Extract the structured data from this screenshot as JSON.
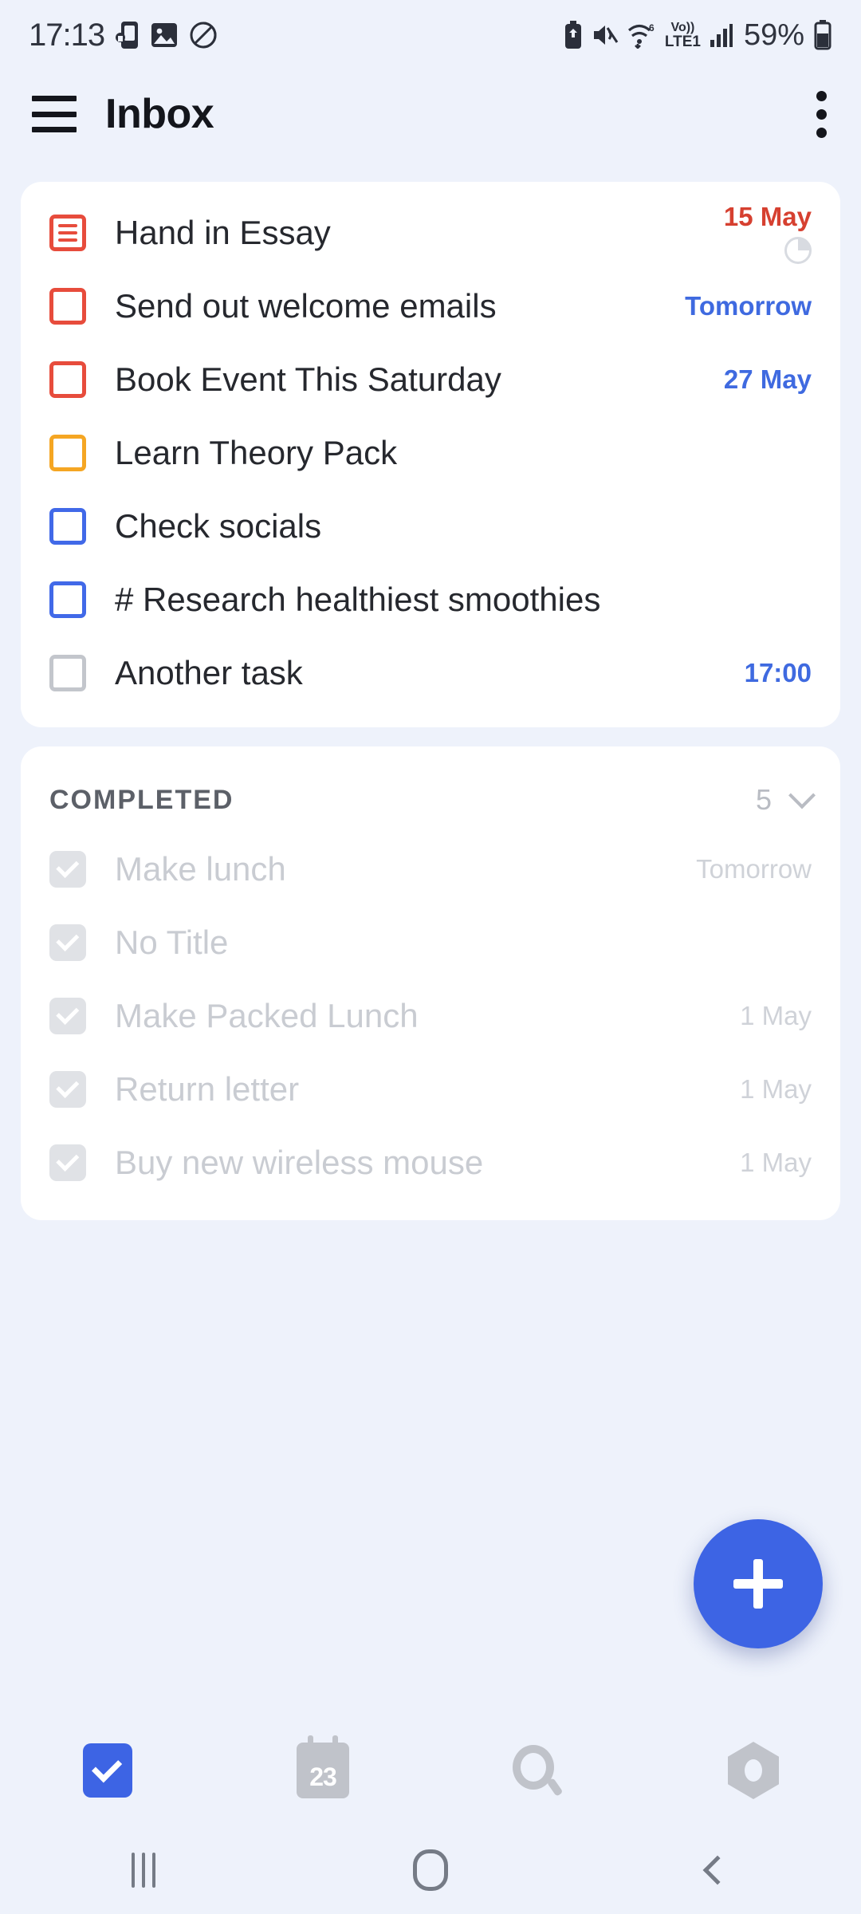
{
  "status_bar": {
    "time": "17:13",
    "left_icons": [
      "phone-lock-icon",
      "image-icon",
      "no-entry-icon"
    ],
    "right_icons": [
      "battery-saver-icon",
      "mute-vibrate-icon",
      "wifi-icon",
      "volte-icon",
      "signal-icon",
      "battery-icon"
    ],
    "wifi_generation": "6",
    "volte_top": "Vo))",
    "volte_bottom": "LTE1",
    "battery_percent": "59%"
  },
  "app_bar": {
    "menu_icon": "hamburger-icon",
    "title": "Inbox",
    "overflow_icon": "more-vertical-icon"
  },
  "colors": {
    "accent": "#3d64e4",
    "overdue": "#d64030",
    "due": "#3f6ae0",
    "priority_high": "#e74c3c",
    "priority_medium": "#f5a623",
    "priority_low": "#4169e8",
    "priority_none": "#cfd2d8",
    "background": "#eef2fb",
    "card": "#ffffff"
  },
  "tasks": [
    {
      "title": "Hand in Essay",
      "checkbox": "list",
      "checkbox_color": "red",
      "date": "15 May",
      "date_color": "red",
      "progress_icon": "pie-progress-icon"
    },
    {
      "title": "Send out welcome emails",
      "checkbox": "box",
      "checkbox_color": "red",
      "date": "Tomorrow",
      "date_color": "blue",
      "progress_icon": ""
    },
    {
      "title": "Book Event This Saturday",
      "checkbox": "box",
      "checkbox_color": "red",
      "date": "27 May",
      "date_color": "blue",
      "progress_icon": ""
    },
    {
      "title": "Learn Theory Pack",
      "checkbox": "box",
      "checkbox_color": "yellow",
      "date": "",
      "date_color": "blue",
      "progress_icon": ""
    },
    {
      "title": "Check socials",
      "checkbox": "box",
      "checkbox_color": "blue",
      "date": "",
      "date_color": "blue",
      "progress_icon": ""
    },
    {
      "title": "# Research healthiest smoothies",
      "checkbox": "box",
      "checkbox_color": "blue",
      "date": "",
      "date_color": "blue",
      "progress_icon": ""
    },
    {
      "title": "Another task",
      "checkbox": "box",
      "checkbox_color": "grey",
      "date": "17:00",
      "date_color": "blue",
      "progress_icon": ""
    }
  ],
  "completed_section": {
    "header": "COMPLETED",
    "count": "5",
    "chevron_icon": "chevron-down-icon",
    "items": [
      {
        "title": "Make lunch",
        "date": "Tomorrow"
      },
      {
        "title": "No Title",
        "date": ""
      },
      {
        "title": "Make Packed Lunch",
        "date": "1 May"
      },
      {
        "title": "Return letter",
        "date": "1 May"
      },
      {
        "title": "Buy new wireless mouse",
        "date": "1 May"
      }
    ]
  },
  "fab": {
    "icon": "plus-icon",
    "label": "Add task"
  },
  "bottom_nav": [
    {
      "name": "tasks",
      "icon": "checkbox-icon",
      "active": true
    },
    {
      "name": "calendar",
      "icon": "calendar-icon",
      "day": "23",
      "active": false
    },
    {
      "name": "search",
      "icon": "search-icon",
      "active": false
    },
    {
      "name": "settings",
      "icon": "gear-icon",
      "active": false
    }
  ],
  "android_nav": {
    "recents_icon": "recents-icon",
    "home_icon": "home-icon",
    "back_icon": "back-icon"
  }
}
